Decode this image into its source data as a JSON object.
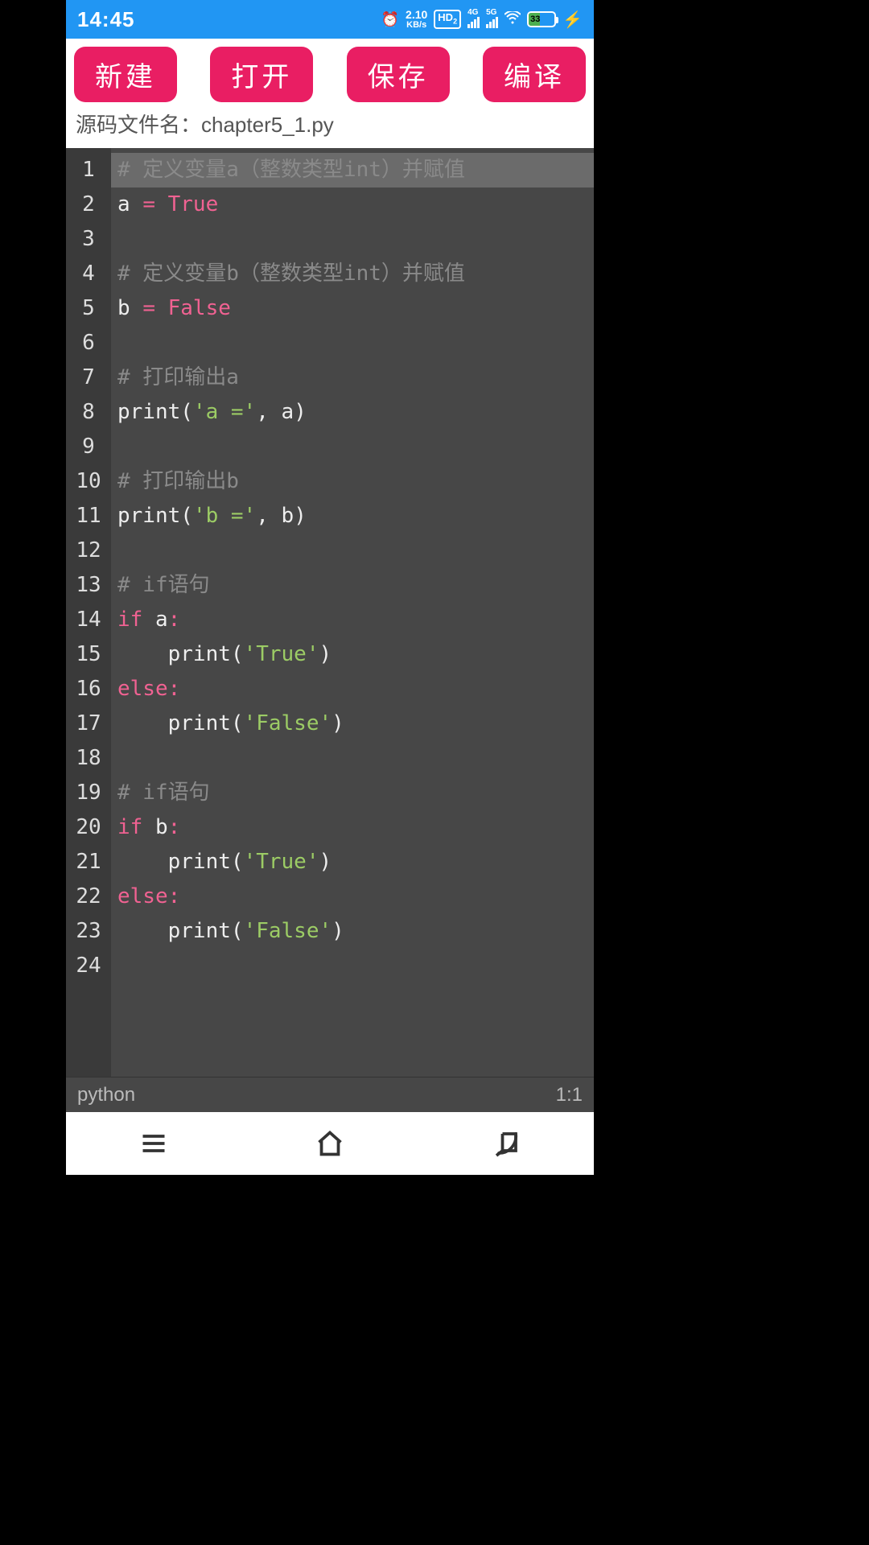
{
  "status_bar": {
    "time": "14:45",
    "net_speed_value": "2.10",
    "net_speed_unit": "KB/s",
    "hd_label": "HD",
    "sig1_label": "4G",
    "sig2_label": "5G",
    "battery_pct": "33"
  },
  "toolbar": {
    "new_label": "新建",
    "open_label": "打开",
    "save_label": "保存",
    "compile_label": "编译",
    "filename_prefix": "源码文件名：",
    "filename": "chapter5_1.py"
  },
  "editor": {
    "highlighted_line": 1,
    "lines": [
      {
        "n": 1,
        "tokens": [
          {
            "c": "tok-cmt",
            "t": "# 定义变量a（整数类型int）并赋值"
          }
        ]
      },
      {
        "n": 2,
        "tokens": [
          {
            "c": "tok-var",
            "t": "a "
          },
          {
            "c": "tok-op",
            "t": "="
          },
          {
            "c": "tok-var",
            "t": " "
          },
          {
            "c": "tok-bool",
            "t": "True"
          }
        ]
      },
      {
        "n": 3,
        "tokens": []
      },
      {
        "n": 4,
        "tokens": [
          {
            "c": "tok-cmt",
            "t": "# 定义变量b（整数类型int）并赋值"
          }
        ]
      },
      {
        "n": 5,
        "tokens": [
          {
            "c": "tok-var",
            "t": "b "
          },
          {
            "c": "tok-op",
            "t": "="
          },
          {
            "c": "tok-var",
            "t": " "
          },
          {
            "c": "tok-bool",
            "t": "False"
          }
        ]
      },
      {
        "n": 6,
        "tokens": []
      },
      {
        "n": 7,
        "tokens": [
          {
            "c": "tok-cmt",
            "t": "# 打印输出a"
          }
        ]
      },
      {
        "n": 8,
        "tokens": [
          {
            "c": "tok-fn",
            "t": "print"
          },
          {
            "c": "tok-pn",
            "t": "("
          },
          {
            "c": "tok-str",
            "t": "'a ='"
          },
          {
            "c": "tok-pn",
            "t": ", "
          },
          {
            "c": "tok-var",
            "t": "a"
          },
          {
            "c": "tok-pn",
            "t": ")"
          }
        ]
      },
      {
        "n": 9,
        "tokens": []
      },
      {
        "n": 10,
        "tokens": [
          {
            "c": "tok-cmt",
            "t": "# 打印输出b"
          }
        ]
      },
      {
        "n": 11,
        "tokens": [
          {
            "c": "tok-fn",
            "t": "print"
          },
          {
            "c": "tok-pn",
            "t": "("
          },
          {
            "c": "tok-str",
            "t": "'b ='"
          },
          {
            "c": "tok-pn",
            "t": ", "
          },
          {
            "c": "tok-var",
            "t": "b"
          },
          {
            "c": "tok-pn",
            "t": ")"
          }
        ]
      },
      {
        "n": 12,
        "tokens": []
      },
      {
        "n": 13,
        "tokens": [
          {
            "c": "tok-cmt",
            "t": "# if语句"
          }
        ]
      },
      {
        "n": 14,
        "tokens": [
          {
            "c": "tok-kw",
            "t": "if"
          },
          {
            "c": "tok-var",
            "t": " a"
          },
          {
            "c": "tok-op",
            "t": ":"
          }
        ]
      },
      {
        "n": 15,
        "tokens": [
          {
            "c": "tok-var",
            "t": "    "
          },
          {
            "c": "tok-fn",
            "t": "print"
          },
          {
            "c": "tok-pn",
            "t": "("
          },
          {
            "c": "tok-str",
            "t": "'True'"
          },
          {
            "c": "tok-pn",
            "t": ")"
          }
        ]
      },
      {
        "n": 16,
        "tokens": [
          {
            "c": "tok-kw",
            "t": "else"
          },
          {
            "c": "tok-op",
            "t": ":"
          }
        ]
      },
      {
        "n": 17,
        "tokens": [
          {
            "c": "tok-var",
            "t": "    "
          },
          {
            "c": "tok-fn",
            "t": "print"
          },
          {
            "c": "tok-pn",
            "t": "("
          },
          {
            "c": "tok-str",
            "t": "'False'"
          },
          {
            "c": "tok-pn",
            "t": ")"
          }
        ]
      },
      {
        "n": 18,
        "tokens": []
      },
      {
        "n": 19,
        "tokens": [
          {
            "c": "tok-cmt",
            "t": "# if语句"
          }
        ]
      },
      {
        "n": 20,
        "tokens": [
          {
            "c": "tok-kw",
            "t": "if"
          },
          {
            "c": "tok-var",
            "t": " b"
          },
          {
            "c": "tok-op",
            "t": ":"
          }
        ]
      },
      {
        "n": 21,
        "tokens": [
          {
            "c": "tok-var",
            "t": "    "
          },
          {
            "c": "tok-fn",
            "t": "print"
          },
          {
            "c": "tok-pn",
            "t": "("
          },
          {
            "c": "tok-str",
            "t": "'True'"
          },
          {
            "c": "tok-pn",
            "t": ")"
          }
        ]
      },
      {
        "n": 22,
        "tokens": [
          {
            "c": "tok-kw",
            "t": "else"
          },
          {
            "c": "tok-op",
            "t": ":"
          }
        ]
      },
      {
        "n": 23,
        "tokens": [
          {
            "c": "tok-var",
            "t": "    "
          },
          {
            "c": "tok-fn",
            "t": "print"
          },
          {
            "c": "tok-pn",
            "t": "("
          },
          {
            "c": "tok-str",
            "t": "'False'"
          },
          {
            "c": "tok-pn",
            "t": ")"
          }
        ]
      },
      {
        "n": 24,
        "tokens": []
      }
    ]
  },
  "statusline": {
    "language": "python",
    "cursor": "1:1"
  }
}
